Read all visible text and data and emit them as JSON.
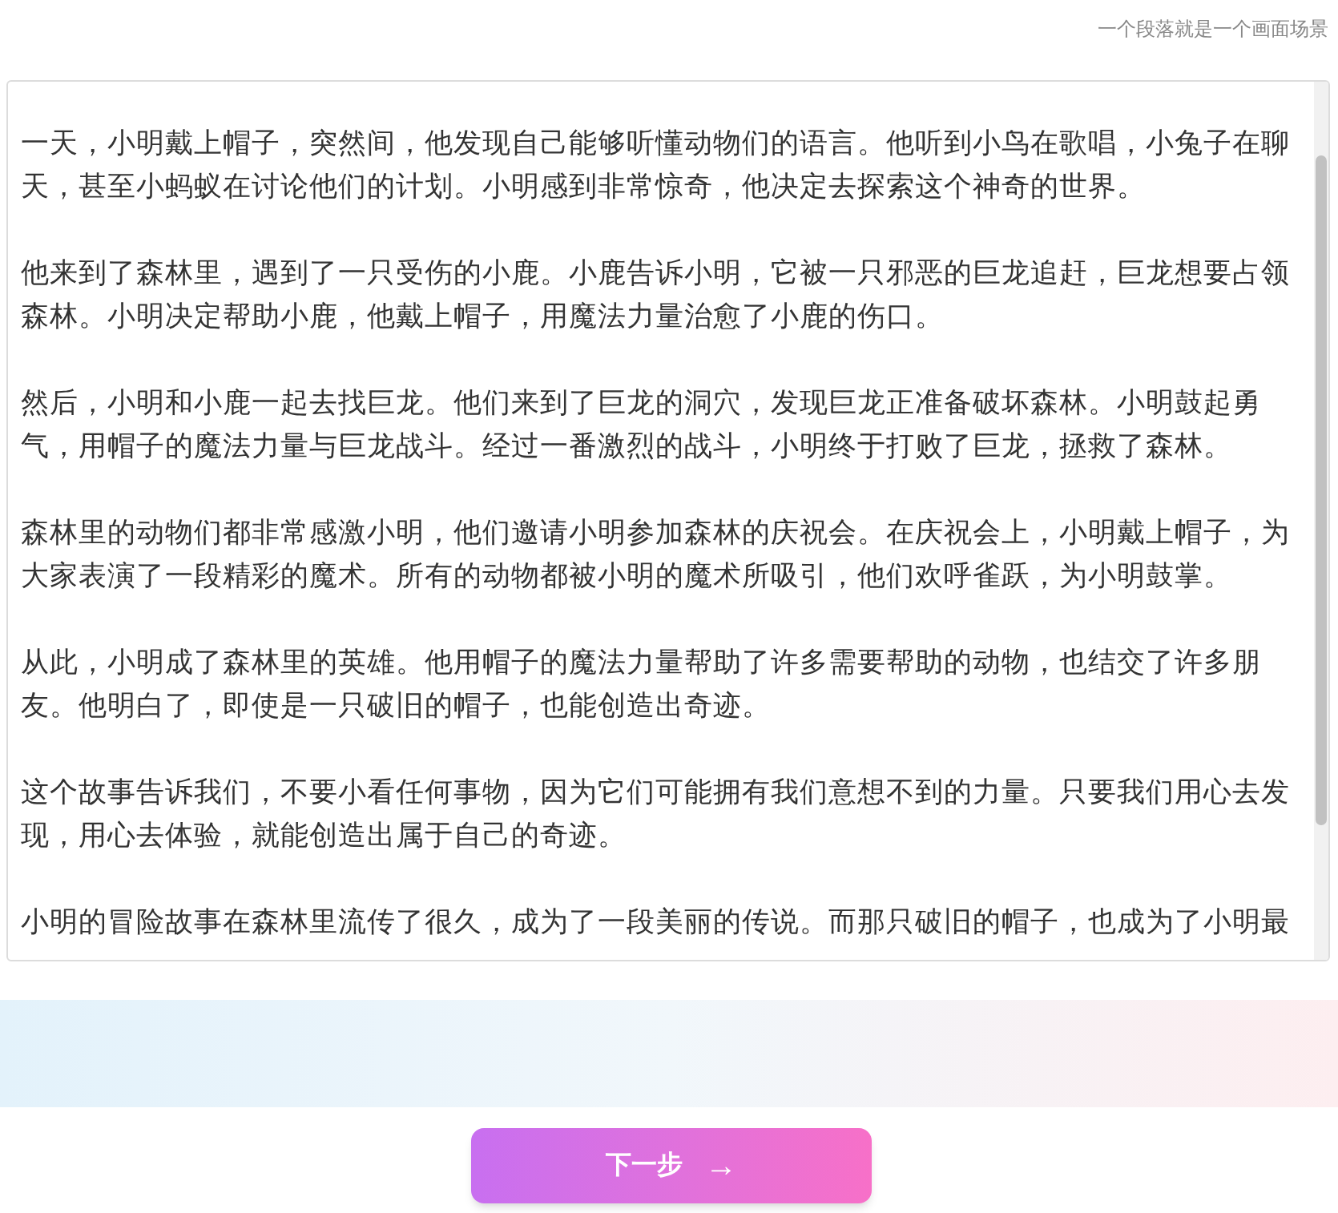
{
  "hint": "一个段落就是一个画面场景",
  "story_paragraphs": [
    "一天，小明戴上帽子，突然间，他发现自己能够听懂动物们的语言。他听到小鸟在歌唱，小兔子在聊天，甚至小蚂蚁在讨论他们的计划。小明感到非常惊奇，他决定去探索这个神奇的世界。",
    "他来到了森林里，遇到了一只受伤的小鹿。小鹿告诉小明，它被一只邪恶的巨龙追赶，巨龙想要占领森林。小明决定帮助小鹿，他戴上帽子，用魔法力量治愈了小鹿的伤口。",
    "然后，小明和小鹿一起去找巨龙。他们来到了巨龙的洞穴，发现巨龙正准备破坏森林。小明鼓起勇气，用帽子的魔法力量与巨龙战斗。经过一番激烈的战斗，小明终于打败了巨龙，拯救了森林。",
    "森林里的动物们都非常感激小明，他们邀请小明参加森林的庆祝会。在庆祝会上，小明戴上帽子，为大家表演了一段精彩的魔术。所有的动物都被小明的魔术所吸引，他们欢呼雀跃，为小明鼓掌。",
    "从此，小明成了森林里的英雄。他用帽子的魔法力量帮助了许多需要帮助的动物，也结交了许多朋友。他明白了，即使是一只破旧的帽子，也能创造出奇迹。",
    "这个故事告诉我们，不要小看任何事物，因为它们可能拥有我们意想不到的力量。只要我们用心去发现，用心去体验，就能创造出属于自己的奇迹。",
    "小明的冒险故事在森林里流传了很久，成为了一段美丽的传说。而那只破旧的帽子，也成为了小明最"
  ],
  "next_button": {
    "label": "下一步",
    "icon": "→"
  }
}
